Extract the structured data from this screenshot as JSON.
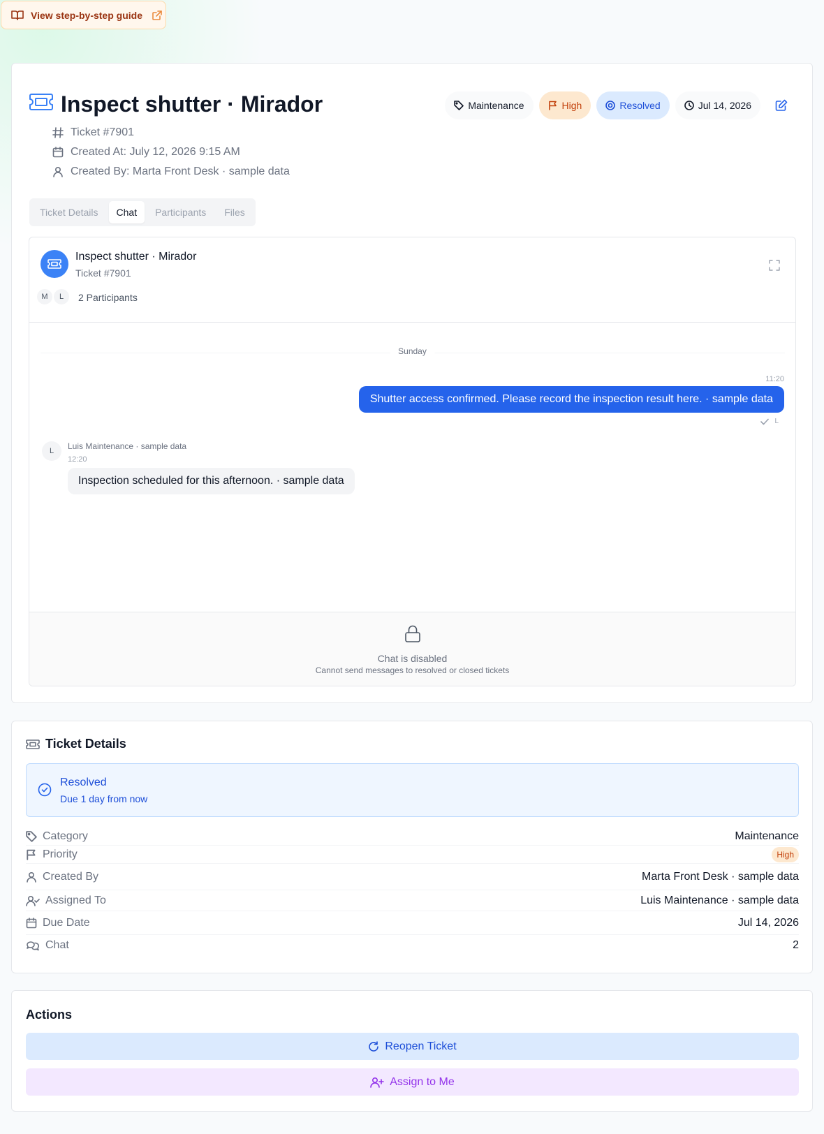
{
  "guide": {
    "label": "View step-by-step guide"
  },
  "header": {
    "title": "Inspect shutter · Mirador",
    "ticket_number": "Ticket #7901",
    "created_at": "Created At: July 12, 2026 9:15 AM",
    "created_by": "Created By: Marta Front Desk · sample data",
    "badges": {
      "category": "Maintenance",
      "priority": "High",
      "status": "Resolved",
      "due": "Jul 14, 2026"
    }
  },
  "tabs": [
    {
      "label": "Ticket Details"
    },
    {
      "label": "Chat"
    },
    {
      "label": "Participants"
    },
    {
      "label": "Files"
    }
  ],
  "chat": {
    "title": "Inspect shutter · Mirador",
    "subtitle": "Ticket #7901",
    "participants": [
      {
        "initial": "M"
      },
      {
        "initial": "L"
      }
    ],
    "participant_count": "2 Participants",
    "day_label": "Sunday",
    "messages": [
      {
        "direction": "outgoing",
        "time": "11:20",
        "text": "Shutter access confirmed. Please record the inspection result here. · sample data",
        "read_by": "L"
      },
      {
        "direction": "incoming",
        "sender": "Luis Maintenance · sample data",
        "initial": "L",
        "time": "12:20",
        "text": "Inspection scheduled for this afternoon. · sample data"
      }
    ],
    "disabled_title": "Chat is disabled",
    "disabled_subtitle": "Cannot send messages to resolved or closed tickets"
  },
  "details": {
    "title": "Ticket Details",
    "status": {
      "title": "Resolved",
      "subtitle": "Due 1 day from now"
    },
    "rows": [
      {
        "label": "Category",
        "value": "Maintenance"
      },
      {
        "label": "Priority",
        "value": "High"
      },
      {
        "label": "Created By",
        "value": "Marta Front Desk · sample data"
      },
      {
        "label": "Assigned To",
        "value": "Luis Maintenance · sample data"
      },
      {
        "label": "Due Date",
        "value": "Jul 14, 2026"
      },
      {
        "label": "Chat",
        "value": "2"
      }
    ]
  },
  "actions": {
    "title": "Actions",
    "reopen": "Reopen Ticket",
    "assign": "Assign to Me"
  },
  "colors": {
    "accent": "#2563eb",
    "priority_high_bg": "#fde8cf",
    "priority_high_text": "#c2410c",
    "resolved_bg": "#dbeafe",
    "assign_bg": "#f3e8ff",
    "assign_text": "#9333ea"
  }
}
